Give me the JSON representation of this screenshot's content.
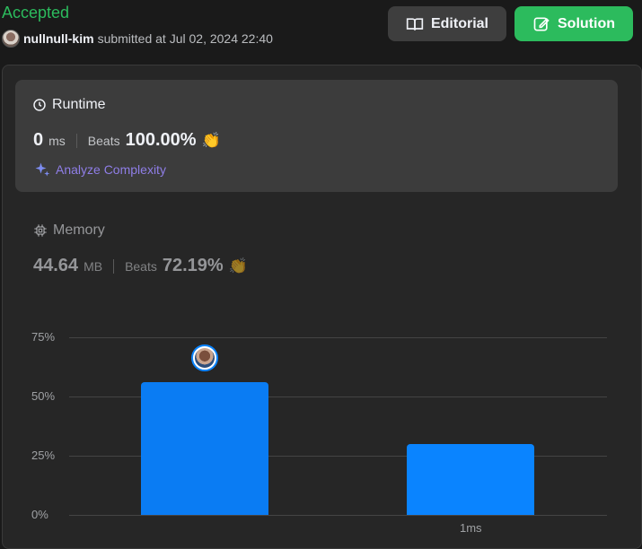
{
  "submission": {
    "status": "Accepted",
    "username": "nullnull-kim",
    "submitted_text": "submitted at Jul 02, 2024 22:40"
  },
  "buttons": {
    "editorial": "Editorial",
    "solution": "Solution"
  },
  "runtime": {
    "title": "Runtime",
    "value": "0",
    "unit": "ms",
    "beats_label": "Beats",
    "beats_value": "100.00%",
    "analyze_label": "Analyze Complexity"
  },
  "memory": {
    "title": "Memory",
    "value": "44.64",
    "unit": "MB",
    "beats_label": "Beats",
    "beats_value": "72.19%"
  },
  "colors": {
    "accent_green": "#2cbb5d",
    "bar_blue": "#0a84ff",
    "analyze_purple": "#8f7ee7"
  },
  "chart_data": {
    "type": "bar",
    "categories": [
      "",
      "1ms"
    ],
    "values": [
      56,
      30
    ],
    "y_ticks": [
      "0%",
      "25%",
      "50%",
      "75%"
    ],
    "ylim": [
      0,
      75
    ],
    "highlighted_index": 0,
    "grid": true
  }
}
